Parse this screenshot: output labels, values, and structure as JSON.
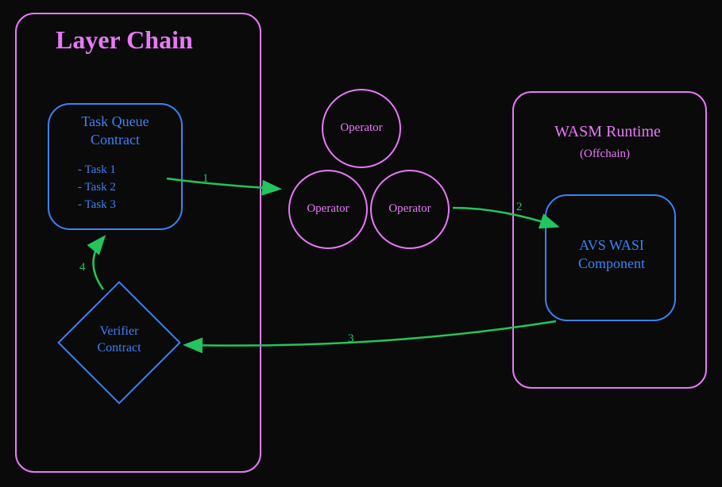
{
  "colors": {
    "background": "#0a0a0a",
    "pink": "#e879f9",
    "blue": "#3b82f6",
    "green": "#22c55e"
  },
  "diagram": {
    "layer_chain": {
      "title": "Layer Chain",
      "task_queue": {
        "title": "Task Queue\nContract",
        "items": [
          "- Task 1",
          "- Task 2",
          "- Task 3"
        ]
      },
      "verifier": {
        "label": "Verifier\nContract"
      }
    },
    "operators": {
      "label": "Operator"
    },
    "wasm_runtime": {
      "title": "WASM Runtime",
      "subtitle": "(Offchain)",
      "component": {
        "label": "AVS WASI\nComponent"
      }
    },
    "arrows": {
      "a1": "1",
      "a2": "2",
      "a3": "3",
      "a4": "4"
    }
  }
}
